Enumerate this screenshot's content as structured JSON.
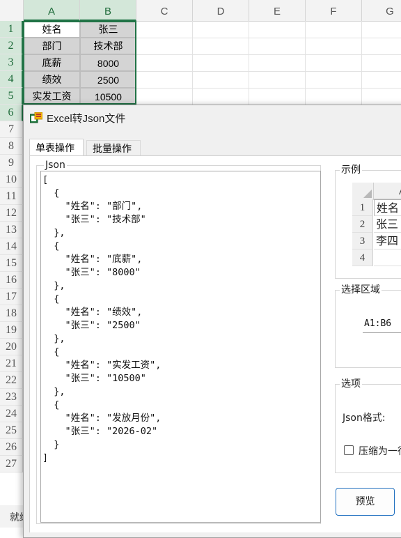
{
  "sheet": {
    "columns": [
      "A",
      "B",
      "C",
      "D",
      "E",
      "F",
      "G"
    ],
    "rows": [
      "1",
      "2",
      "3",
      "4",
      "5",
      "6",
      "7",
      "8",
      "9",
      "10",
      "11",
      "12",
      "13",
      "14",
      "15",
      "16",
      "17",
      "18",
      "19",
      "20",
      "21",
      "22",
      "23",
      "24",
      "25",
      "26",
      "27"
    ],
    "cells": [
      [
        "姓名",
        "张三"
      ],
      [
        "部门",
        "技术部"
      ],
      [
        "底薪",
        "8000"
      ],
      [
        "绩效",
        "2500"
      ],
      [
        "实发工资",
        "10500"
      ]
    ],
    "status_text": "就绪"
  },
  "dialog": {
    "title": "Excel转Json文件",
    "tabs": [
      "单表操作",
      "批量操作"
    ],
    "json_group_label": "Json",
    "json_text": "[\n  {\n    \"姓名\": \"部门\",\n    \"张三\": \"技术部\"\n  },\n  {\n    \"姓名\": \"底薪\",\n    \"张三\": \"8000\"\n  },\n  {\n    \"姓名\": \"绩效\",\n    \"张三\": \"2500\"\n  },\n  {\n    \"姓名\": \"实发工资\",\n    \"张三\": \"10500\"\n  },\n  {\n    \"姓名\": \"发放月份\",\n    \"张三\": \"2026-02\"\n  }\n]",
    "example_group_label": "示例",
    "example": {
      "col_header": "A",
      "rows": [
        "1",
        "2",
        "3",
        "4"
      ],
      "cells": [
        "姓名",
        "张三",
        "李四",
        ""
      ]
    },
    "range_group_label": "选择区域",
    "range_value": "A1:B6",
    "options_group_label": "选项",
    "json_format_label": "Json格式:",
    "compress_label": "压缩为一行",
    "preview_button": "预览"
  }
}
